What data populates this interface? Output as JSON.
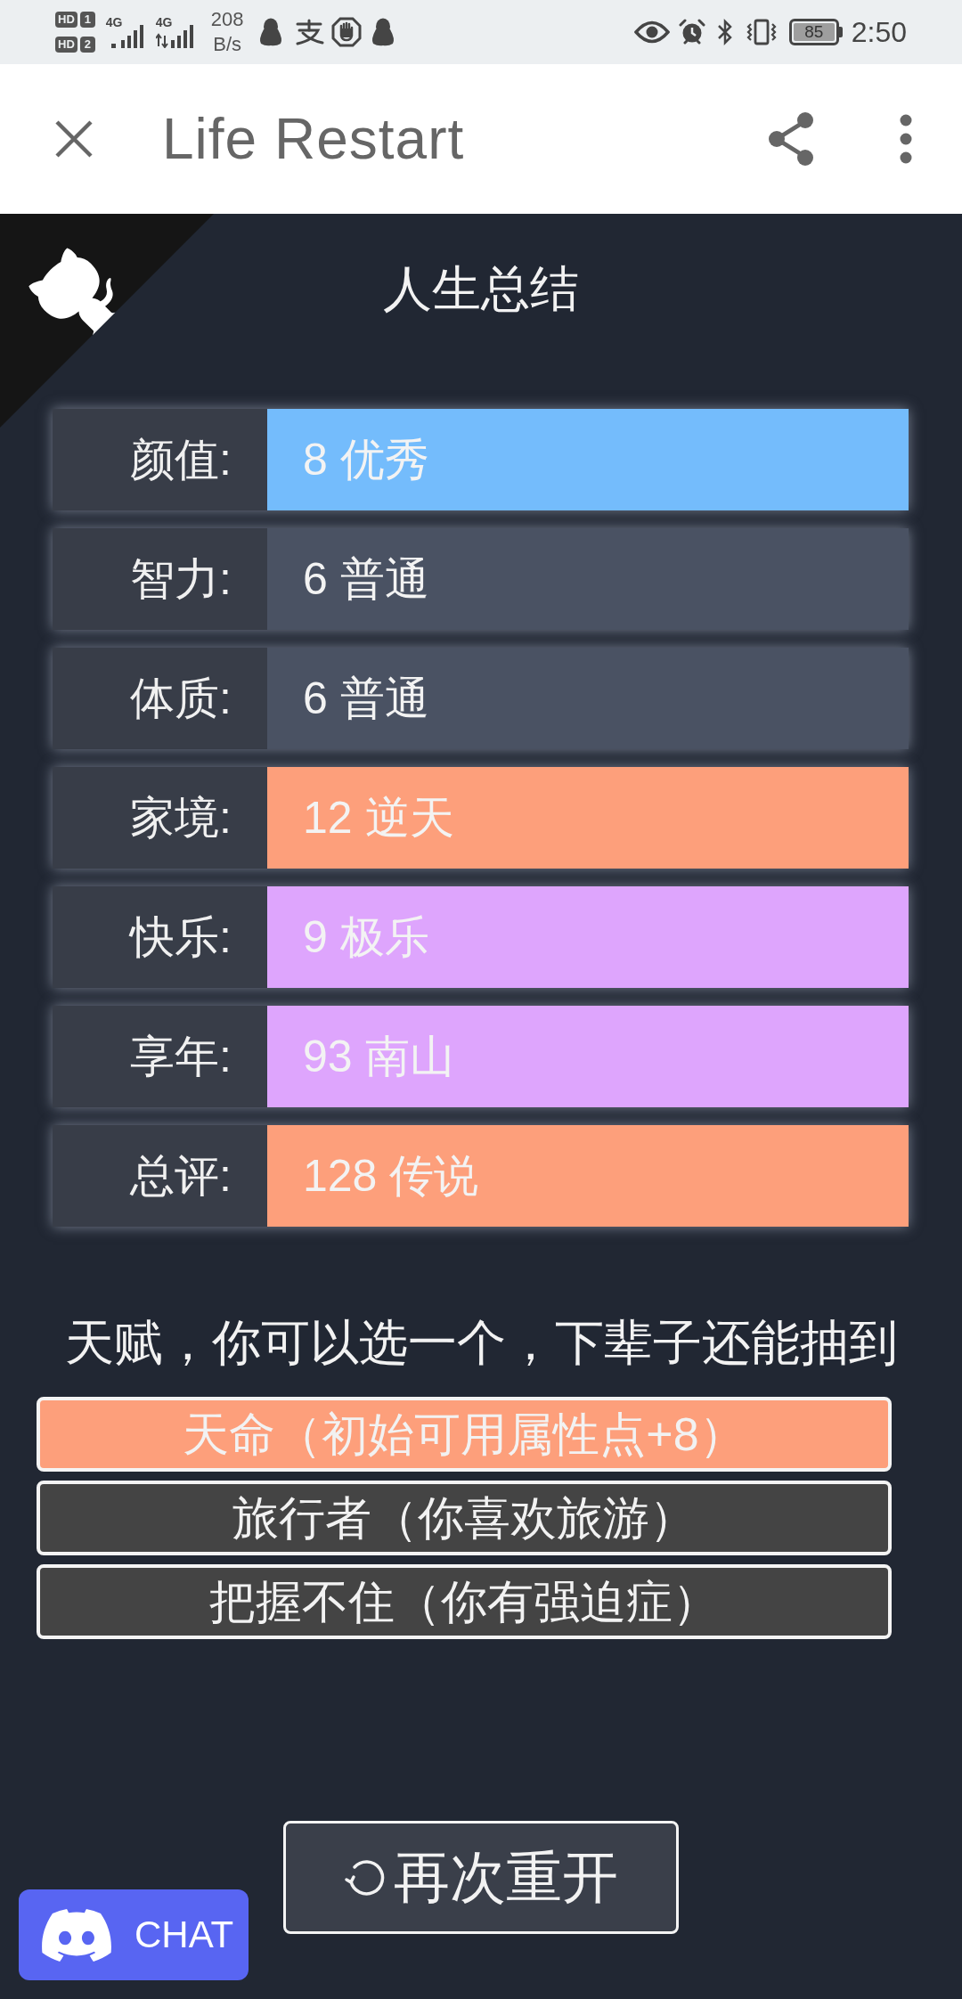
{
  "status_bar": {
    "sims": [
      {
        "badge": "HD",
        "slot": "1"
      },
      {
        "badge": "HD",
        "slot": "2"
      }
    ],
    "networks": [
      {
        "type": "4G",
        "transferring": false
      },
      {
        "type": "4G",
        "transferring": true
      }
    ],
    "speed": {
      "value": "208",
      "unit": "B/s"
    },
    "battery": "85",
    "time": "2:50"
  },
  "app_bar": {
    "title": "Life Restart"
  },
  "summary": {
    "title": "人生总结",
    "rows": [
      {
        "label": "颜值:",
        "value": "8 优秀",
        "color": "#74bcfc"
      },
      {
        "label": "智力:",
        "value": "6 普通",
        "color": "#4a5263"
      },
      {
        "label": "体质:",
        "value": "6 普通",
        "color": "#4a5263"
      },
      {
        "label": "家境:",
        "value": "12 逆天",
        "color": "#fd9f7b"
      },
      {
        "label": "快乐:",
        "value": "9 极乐",
        "color": "#dea5fd"
      },
      {
        "label": "享年:",
        "value": "93 南山",
        "color": "#dea5fd"
      },
      {
        "label": "总评:",
        "value": "128 传说",
        "color": "#fd9f7b"
      }
    ]
  },
  "talents": {
    "heading": "天赋，你可以选一个，下辈子还能抽到",
    "items": [
      {
        "label": "天命（初始可用属性点+8）",
        "color": "#fd9f7b"
      },
      {
        "label": "旅行者（你喜欢旅游）",
        "color": "#444444"
      },
      {
        "label": "把握不住（你有强迫症）",
        "color": "#444444"
      }
    ]
  },
  "restart_button": {
    "label": "再次重开"
  },
  "chat_button": {
    "label": "CHAT"
  }
}
